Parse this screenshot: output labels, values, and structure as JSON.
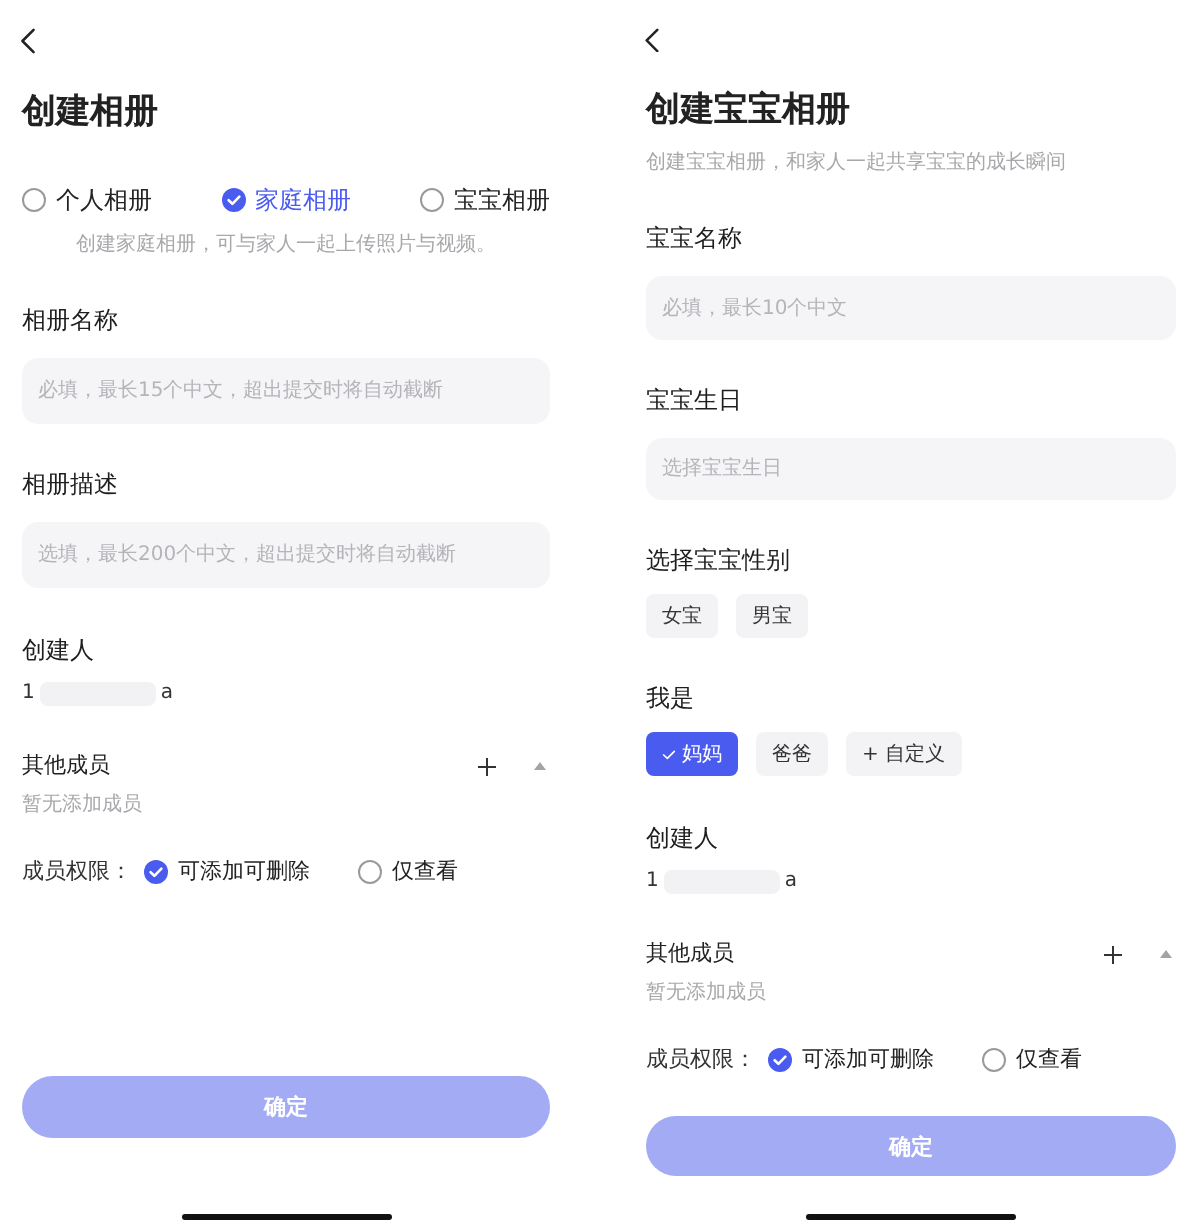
{
  "screens": [
    {
      "title": "创建相册",
      "album_types": [
        {
          "label": "个人相册",
          "selected": false
        },
        {
          "label": "家庭相册",
          "selected": true
        },
        {
          "label": "宝宝相册",
          "selected": false
        }
      ],
      "type_hint": "创建家庭相册，可与家人一起上传照片与视频。",
      "fields": [
        {
          "label": "相册名称",
          "placeholder": "必填，最长15个中文，超出提交时将自动截断"
        },
        {
          "label": "相册描述",
          "placeholder": "选填，最长200个中文，超出提交时将自动截断"
        }
      ],
      "creator": {
        "label": "创建人",
        "value_start": "1",
        "value_end": "a"
      },
      "members": {
        "label": "其他成员",
        "expanded": true,
        "empty_text": "暂无添加成员"
      },
      "permissions": {
        "label": "成员权限：",
        "options": [
          {
            "label": "可添加可删除",
            "selected": true
          },
          {
            "label": "仅查看",
            "selected": false
          }
        ]
      },
      "confirm_button": {
        "label": "确定",
        "disabled": true
      }
    },
    {
      "title": "创建宝宝相册",
      "subtitle": "创建宝宝相册，和家人一起共享宝宝的成长瞬间",
      "fields": [
        {
          "label": "宝宝名称",
          "placeholder": "必填，最长10个中文"
        },
        {
          "label": "宝宝生日",
          "placeholder": "选择宝宝生日"
        }
      ],
      "choice_groups": [
        {
          "label": "选择宝宝性别",
          "options": [
            {
              "label": "女宝",
              "selected": false
            },
            {
              "label": "男宝",
              "selected": false
            }
          ]
        },
        {
          "label": "我是",
          "options": [
            {
              "label": "妈妈",
              "selected": true
            },
            {
              "label": "爸爸",
              "selected": false
            },
            {
              "label": "+ 自定义",
              "selected": false
            }
          ]
        }
      ],
      "creator": {
        "label": "创建人",
        "value_start": "1",
        "value_end": "a"
      },
      "members": {
        "label": "其他成员",
        "expanded": true,
        "empty_text": "暂无添加成员"
      },
      "permissions": {
        "label": "成员权限：",
        "options": [
          {
            "label": "可添加可删除",
            "selected": true
          },
          {
            "label": "仅查看",
            "selected": false
          }
        ]
      },
      "confirm_button": {
        "label": "确定",
        "disabled": true
      }
    }
  ]
}
